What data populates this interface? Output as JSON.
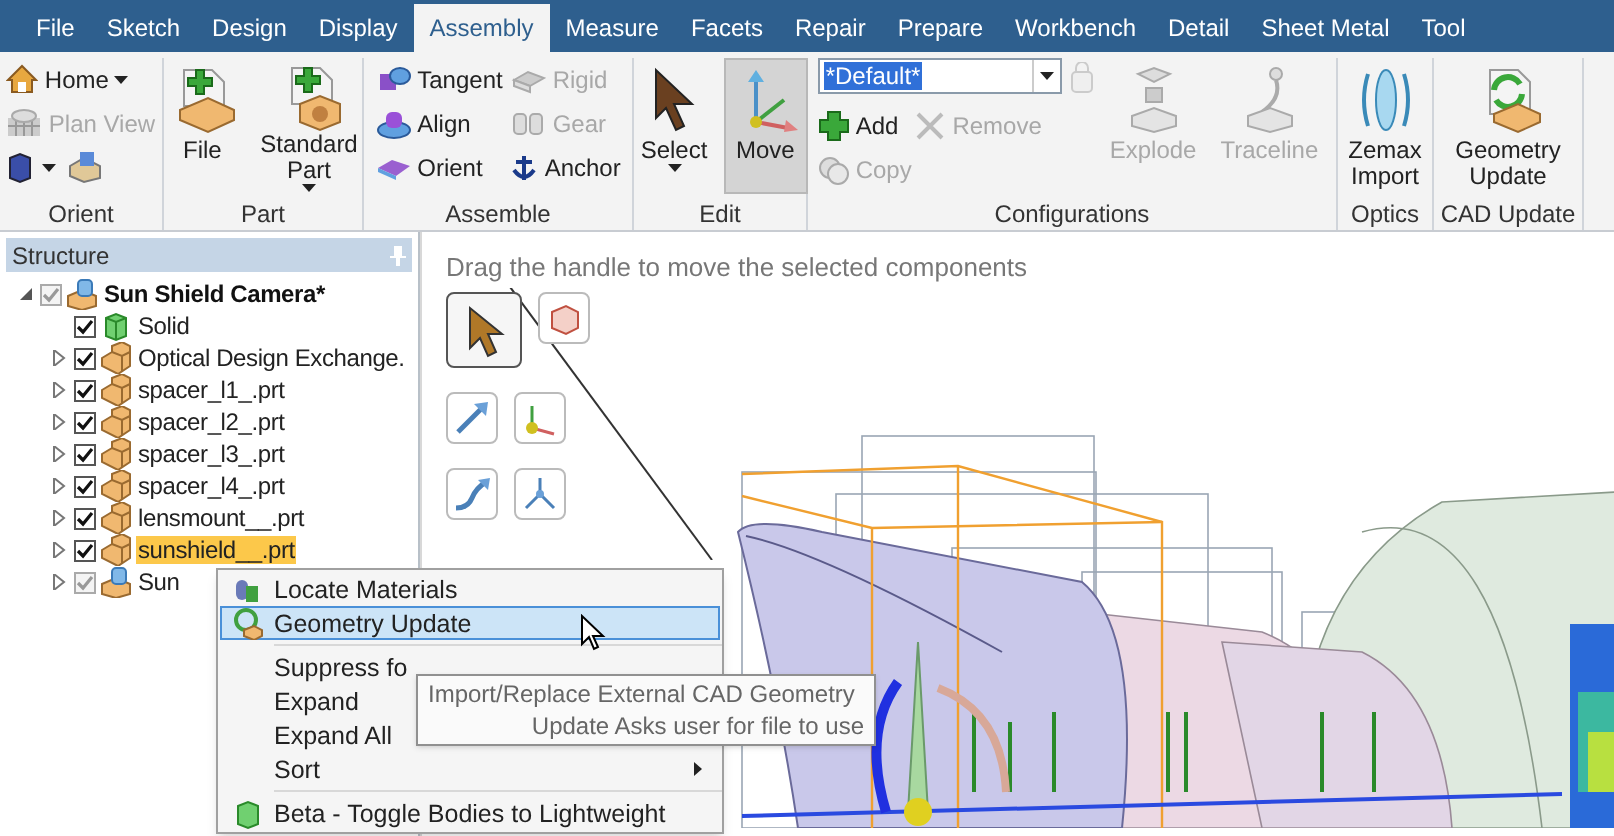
{
  "tabs": [
    {
      "label": "File",
      "selected": false
    },
    {
      "label": "Sketch",
      "selected": false
    },
    {
      "label": "Design",
      "selected": false
    },
    {
      "label": "Display",
      "selected": false
    },
    {
      "label": "Assembly",
      "selected": true
    },
    {
      "label": "Measure",
      "selected": false
    },
    {
      "label": "Facets",
      "selected": false
    },
    {
      "label": "Repair",
      "selected": false
    },
    {
      "label": "Prepare",
      "selected": false
    },
    {
      "label": "Workbench",
      "selected": false
    },
    {
      "label": "Detail",
      "selected": false
    },
    {
      "label": "Sheet Metal",
      "selected": false
    },
    {
      "label": "Tool",
      "selected": false
    }
  ],
  "ribbon": {
    "groups": [
      {
        "label": "Orient",
        "columns": [
          [
            {
              "kind": "small",
              "label": "Home",
              "dropdown": true,
              "disabled": false
            },
            {
              "kind": "small",
              "label": "Plan View",
              "dropdown": false,
              "disabled": true
            },
            {
              "kind": "iconrow",
              "dropdown": true,
              "disabled": false
            }
          ]
        ]
      },
      {
        "label": "Part",
        "columns": [
          [
            {
              "kind": "large",
              "label": "File",
              "dropdown": false,
              "disabled": false
            }
          ],
          [
            {
              "kind": "large",
              "label": "Standard Part",
              "dropdown": true,
              "disabled": false
            }
          ]
        ]
      },
      {
        "label": "Assemble",
        "columns": [
          [
            {
              "kind": "small",
              "label": "Tangent",
              "dropdown": false,
              "disabled": false
            },
            {
              "kind": "small",
              "label": "Align",
              "dropdown": false,
              "disabled": false
            },
            {
              "kind": "small",
              "label": "Orient",
              "dropdown": false,
              "disabled": false
            }
          ],
          [
            {
              "kind": "small",
              "label": "Rigid",
              "dropdown": false,
              "disabled": true
            },
            {
              "kind": "small",
              "label": "Gear",
              "dropdown": false,
              "disabled": true
            },
            {
              "kind": "small",
              "label": "Anchor",
              "dropdown": false,
              "disabled": false
            }
          ]
        ]
      },
      {
        "label": "Edit",
        "columns": [
          [
            {
              "kind": "large",
              "label": "Select",
              "dropdown": true,
              "disabled": false,
              "selected": false
            }
          ],
          [
            {
              "kind": "large",
              "label": "Move",
              "dropdown": false,
              "disabled": false,
              "selected": true
            }
          ]
        ]
      },
      {
        "label": "Configurations",
        "columns": [
          [
            {
              "kind": "combo",
              "value": "*Default*",
              "disabled": false
            },
            {
              "kind": "row",
              "items": [
                {
                  "kind": "small",
                  "label": "Add",
                  "dropdown": false,
                  "disabled": false
                },
                {
                  "kind": "small",
                  "label": "Remove",
                  "dropdown": false,
                  "disabled": true
                }
              ]
            },
            {
              "kind": "small",
              "label": "Copy",
              "dropdown": false,
              "disabled": true
            }
          ],
          [
            {
              "kind": "lock",
              "disabled": true
            }
          ],
          [
            {
              "kind": "large",
              "label": "Explode",
              "dropdown": false,
              "disabled": true
            }
          ],
          [
            {
              "kind": "large",
              "label": "Traceline",
              "dropdown": false,
              "disabled": true
            }
          ]
        ]
      },
      {
        "label": "Optics",
        "columns": [
          [
            {
              "kind": "large",
              "label": "Zemax Import",
              "dropdown": false,
              "disabled": false
            }
          ]
        ]
      },
      {
        "label": "CAD Update",
        "columns": [
          [
            {
              "kind": "large",
              "label": "Geometry Update",
              "dropdown": false,
              "disabled": false
            }
          ]
        ]
      }
    ]
  },
  "structure": {
    "title": "Structure",
    "tree": [
      {
        "label": "Sun Shield Camera*",
        "kind": "assembly",
        "checked": true,
        "expanded": true,
        "selected": false,
        "children": [
          {
            "label": "Solid",
            "kind": "body",
            "checked": true,
            "expandable": false,
            "selected": false
          },
          {
            "label": "Optical Design Exchange.",
            "kind": "component",
            "checked": true,
            "expandable": true,
            "selected": false
          },
          {
            "label": "spacer_l1_.prt",
            "kind": "component",
            "checked": true,
            "expandable": true,
            "selected": false
          },
          {
            "label": "spacer_l2_.prt",
            "kind": "component",
            "checked": true,
            "expandable": true,
            "selected": false
          },
          {
            "label": "spacer_l3_.prt",
            "kind": "component",
            "checked": true,
            "expandable": true,
            "selected": false
          },
          {
            "label": "spacer_l4_.prt",
            "kind": "component",
            "checked": true,
            "expandable": true,
            "selected": false
          },
          {
            "label": "lensmount__.prt",
            "kind": "component",
            "checked": true,
            "expandable": true,
            "selected": false
          },
          {
            "label": "sunshield__.prt",
            "kind": "component",
            "checked": true,
            "expandable": true,
            "selected": true
          },
          {
            "label": "Sun",
            "kind": "assembly",
            "checked": true,
            "expandable": true,
            "selected": false
          }
        ]
      }
    ]
  },
  "viewport": {
    "hint": "Drag the handle to move the selected components",
    "tools": [
      {
        "selected": true
      },
      {
        "selected": false
      },
      {
        "selected": false
      },
      {
        "selected": false
      },
      {
        "selected": false
      },
      {
        "selected": false
      }
    ]
  },
  "context_menu": {
    "items": [
      {
        "kind": "item",
        "label": "Locate Materials",
        "selected": false,
        "submenu": false
      },
      {
        "kind": "item",
        "label": "Geometry Update",
        "selected": true,
        "submenu": false
      },
      {
        "kind": "separator"
      },
      {
        "kind": "item",
        "label": "Suppress fo",
        "selected": false
      },
      {
        "kind": "item",
        "label": "Expand",
        "selected": false
      },
      {
        "kind": "item",
        "label": "Expand All",
        "selected": false
      },
      {
        "kind": "item",
        "label": "Sort",
        "selected": false,
        "submenu": true
      },
      {
        "kind": "separator"
      },
      {
        "kind": "item",
        "label": "Beta - Toggle Bodies to Lightweight",
        "selected": false,
        "submenu": false
      }
    ]
  },
  "tooltip": {
    "lines": [
      "Import/Replace External CAD Geometry",
      "Update Asks user for file to use"
    ]
  }
}
